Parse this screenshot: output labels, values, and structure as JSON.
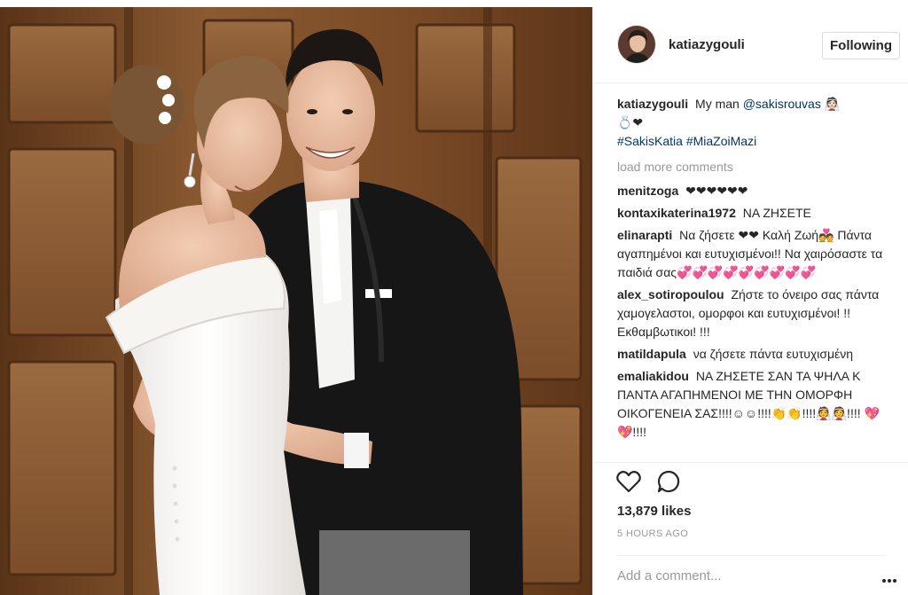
{
  "post": {
    "image_alt": "Wedding photo of a bride in an off-shoulder white gown embracing a smiling groom in a black tailcoat",
    "author": {
      "username": "katiazygouli",
      "follow_label": "Following"
    },
    "caption": {
      "username": "katiazygouli",
      "text": "My man",
      "mention": "@sakisrouvas",
      "emoji_tail": "👰🏻 ",
      "emoji_line2": "💍❤",
      "hashtags": [
        "#SakisKatia",
        "#MiaZoiMazi"
      ]
    },
    "load_more_label": "load more comments",
    "comments": [
      {
        "user": "menitzoga",
        "text": "❤❤❤❤❤❤"
      },
      {
        "user": "kontaxikaterina1972",
        "text": "ΝΑ ΖΗΣΕΤΕ"
      },
      {
        "user": "elinarapti",
        "text": "Να ζήσετε ❤❤ Καλή Ζωή💑 Πάντα αγαπημένοι και ευτυχισμένοι!! Να χαιρόσαστε τα παιδιά σας💞💞💞💞💞💞💞💞💞"
      },
      {
        "user": "alex_sotiropoulou",
        "text": "Ζήστε το όνειρο σας πάντα χαμογελαστοι, ομορφοι και ευτυχισμένοι! !!Εκθαμβωτικοι! !!!"
      },
      {
        "user": "matildapula",
        "text": "να ζήσετε πάντα ευτυχισμένη"
      },
      {
        "user": "emaliakidou",
        "text": "ΝΑ ΖΗΣΕΤΕ ΣΑΝ ΤΑ ΨΗΛΑ Κ ΠΑΝΤΑ ΑΓΑΠΗΜΕΝΟΙ ΜΕ ΤΗΝ ΟΜΟΡΦΗ ΟΙΚΟΓΕΝΕΙΑ ΣΑΣ!!!!☺☺!!!!👏👏!!!!👰👰!!!! 💖💖!!!!"
      }
    ],
    "likes_label": "13,879 likes",
    "time_label": "5 HOURS AGO",
    "add_comment_placeholder": "Add a comment..."
  },
  "icons": {
    "like": "heart-icon",
    "comment": "comment-bubble-icon",
    "more": "more-options-icon"
  },
  "colors": {
    "link": "#003569",
    "muted": "#999999",
    "text": "#262626",
    "border": "#efefef"
  }
}
